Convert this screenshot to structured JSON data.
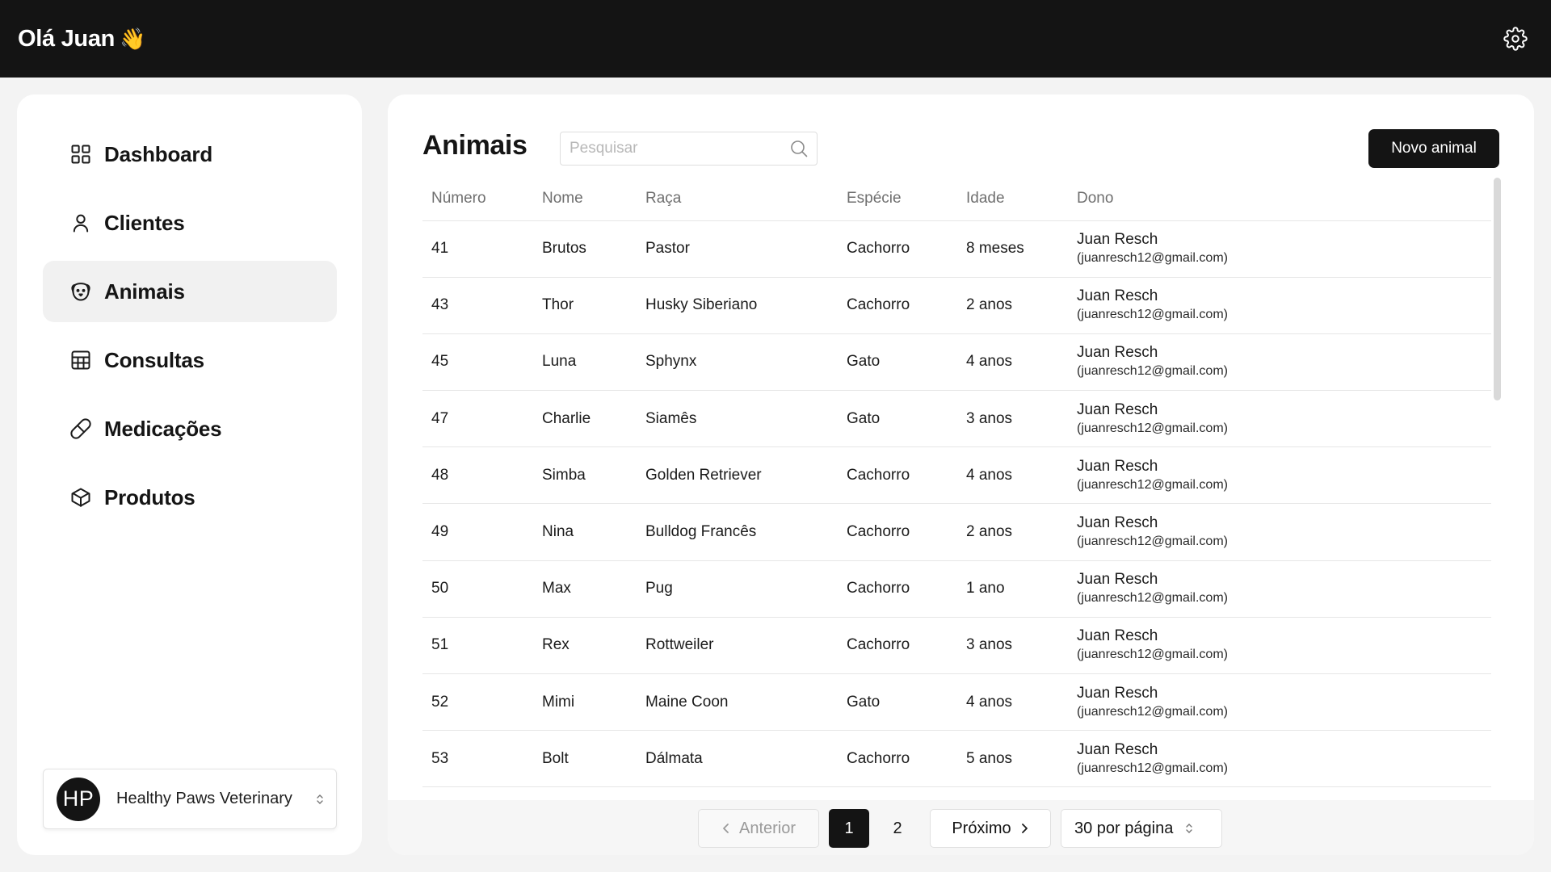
{
  "header": {
    "greeting": "Olá Juan",
    "wave_emoji": "👋",
    "settings_icon": "gear-icon"
  },
  "sidebar": {
    "items": [
      {
        "label": "Dashboard",
        "icon": "dashboard-grid-icon",
        "active": false
      },
      {
        "label": "Clientes",
        "icon": "user-icon",
        "active": false
      },
      {
        "label": "Animais",
        "icon": "pet-face-icon",
        "active": true
      },
      {
        "label": "Consultas",
        "icon": "calendar-table-icon",
        "active": false
      },
      {
        "label": "Medicações",
        "icon": "pill-icon",
        "active": false
      },
      {
        "label": "Produtos",
        "icon": "package-box-icon",
        "active": false
      }
    ],
    "clinic": {
      "initials": "HP",
      "name": "Healthy Paws Veterinary"
    }
  },
  "main": {
    "title": "Animais",
    "search_placeholder": "Pesquisar",
    "new_button": "Novo animal",
    "columns": [
      "Número",
      "Nome",
      "Raça",
      "Espécie",
      "Idade",
      "Dono"
    ],
    "rows": [
      {
        "numero": "41",
        "nome": "Brutos",
        "raca": "Pastor",
        "especie": "Cachorro",
        "idade": "8 meses",
        "dono": "Juan Resch",
        "email": "(juanresch12@gmail.com)"
      },
      {
        "numero": "43",
        "nome": "Thor",
        "raca": "Husky Siberiano",
        "especie": "Cachorro",
        "idade": "2 anos",
        "dono": "Juan Resch",
        "email": "(juanresch12@gmail.com)"
      },
      {
        "numero": "45",
        "nome": "Luna",
        "raca": "Sphynx",
        "especie": "Gato",
        "idade": "4 anos",
        "dono": "Juan Resch",
        "email": "(juanresch12@gmail.com)"
      },
      {
        "numero": "47",
        "nome": "Charlie",
        "raca": "Siamês",
        "especie": "Gato",
        "idade": "3 anos",
        "dono": "Juan Resch",
        "email": "(juanresch12@gmail.com)"
      },
      {
        "numero": "48",
        "nome": "Simba",
        "raca": "Golden Retriever",
        "especie": "Cachorro",
        "idade": "4 anos",
        "dono": "Juan Resch",
        "email": "(juanresch12@gmail.com)"
      },
      {
        "numero": "49",
        "nome": "Nina",
        "raca": "Bulldog Francês",
        "especie": "Cachorro",
        "idade": "2 anos",
        "dono": "Juan Resch",
        "email": "(juanresch12@gmail.com)"
      },
      {
        "numero": "50",
        "nome": "Max",
        "raca": "Pug",
        "especie": "Cachorro",
        "idade": "1 ano",
        "dono": "Juan Resch",
        "email": "(juanresch12@gmail.com)"
      },
      {
        "numero": "51",
        "nome": "Rex",
        "raca": "Rottweiler",
        "especie": "Cachorro",
        "idade": "3 anos",
        "dono": "Juan Resch",
        "email": "(juanresch12@gmail.com)"
      },
      {
        "numero": "52",
        "nome": "Mimi",
        "raca": "Maine Coon",
        "especie": "Gato",
        "idade": "4 anos",
        "dono": "Juan Resch",
        "email": "(juanresch12@gmail.com)"
      },
      {
        "numero": "53",
        "nome": "Bolt",
        "raca": "Dálmata",
        "especie": "Cachorro",
        "idade": "5 anos",
        "dono": "Juan Resch",
        "email": "(juanresch12@gmail.com)"
      }
    ]
  },
  "pagination": {
    "prev_label": "Anterior",
    "pages": [
      "1",
      "2"
    ],
    "current_page": "1",
    "next_label": "Próximo",
    "page_size_label": "30 por página"
  },
  "colors": {
    "topbar": "#141414",
    "background": "#f3f3f3",
    "accent": "#141414",
    "active_nav": "#f1f1f1"
  }
}
